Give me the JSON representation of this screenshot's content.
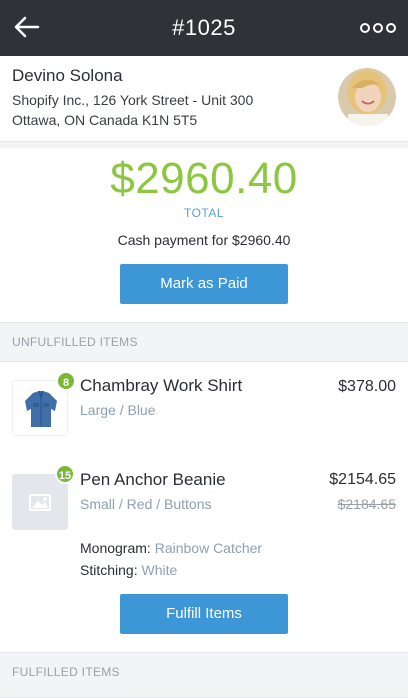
{
  "header": {
    "title": "#1025",
    "back_icon": "arrow-left-icon",
    "more_icon": "more-dots-icon"
  },
  "customer": {
    "name": "Devino Solona",
    "address_line1": "Shopify Inc., 126 York Street - Unit 300",
    "address_line2": "Ottawa, ON Canada K1N 5T5",
    "avatar_icon": "customer-avatar"
  },
  "payment": {
    "amount": "$2960.40",
    "total_label": "TOTAL",
    "note": "Cash payment for $2960.40",
    "mark_paid_label": "Mark as Paid"
  },
  "sections": {
    "unfulfilled": "UNFULFILLED ITEMS",
    "fulfilled": "FULFILLED ITEMS"
  },
  "items": [
    {
      "quantity": "8",
      "name": "Chambray Work Shirt",
      "variant": "Large / Blue",
      "price": "$378.00",
      "thumbnail_icon": "shirt-image"
    },
    {
      "quantity": "15",
      "name": "Pen Anchor Beanie",
      "variant": "Small / Red / Buttons",
      "price": "$2154.65",
      "original_price": "$2184.65",
      "thumbnail_icon": "image-placeholder-icon",
      "properties": [
        {
          "key": "Monogram:",
          "value": "Rainbow Catcher"
        },
        {
          "key": "Stitching:",
          "value": "White"
        }
      ]
    }
  ],
  "fulfill_label": "Fulfill Items",
  "colors": {
    "accent": "#3d96d6",
    "total": "#8dc63f",
    "badge": "#7ab83a",
    "topbar": "#2f3237"
  }
}
